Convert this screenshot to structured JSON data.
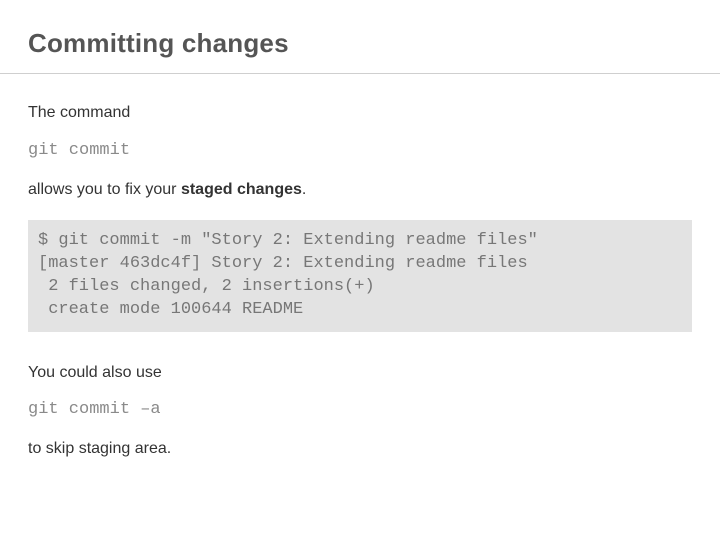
{
  "title": "Committing changes",
  "p1": "The command",
  "cmd1": "git commit",
  "p2_pre": "allows you to fix your ",
  "p2_strong": "staged changes",
  "p2_post": ".",
  "code": {
    "l1": "$ git commit -m \"Story 2: Extending readme files\"",
    "l2": "[master 463dc4f] Story 2: Extending readme files",
    "l3": " 2 files changed, 2 insertions(+)",
    "l4": " create mode 100644 README"
  },
  "p3": "You could also use",
  "cmd2": "git commit –a",
  "p4": "to skip staging area."
}
